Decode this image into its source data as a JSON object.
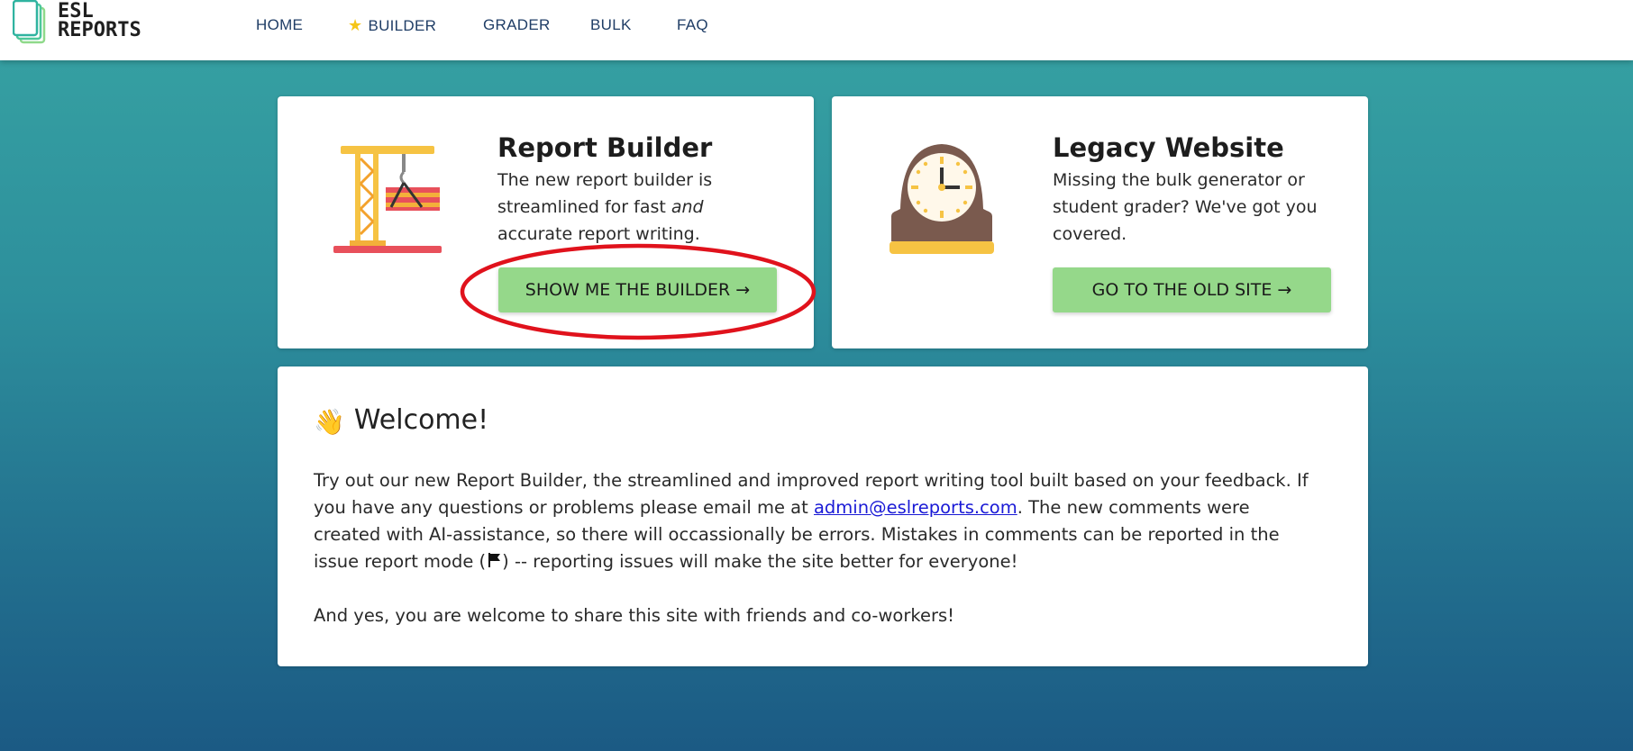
{
  "navbar": {
    "logo_line1": "ESL",
    "logo_line2": "REPORTS",
    "items": [
      {
        "label": "HOME"
      },
      {
        "label": "BUILDER",
        "icon": "star-icon"
      },
      {
        "label": "GRADER"
      },
      {
        "label": "BULK"
      },
      {
        "label": "FAQ"
      }
    ]
  },
  "builder_card": {
    "title": "Report Builder",
    "desc_part1": "The new report builder is streamlined for fast ",
    "desc_emphasis": "and",
    "desc_part2": " accurate report writing.",
    "button_label": "SHOW ME THE BUILDER →",
    "icon": "crane-icon"
  },
  "legacy_card": {
    "title": "Legacy Website",
    "desc": "Missing the bulk generator or student grader? We've got you covered.",
    "button_label": "GO TO THE OLD SITE →",
    "icon": "mantel-clock-icon"
  },
  "welcome": {
    "title": "Welcome!",
    "icon": "waving-hand-icon",
    "p1_part1": "Try out our new Report Builder, the streamlined and improved report writing tool built based on your feedback. If you have any questions or problems please email me at ",
    "email": "admin@eslreports.com",
    "p1_part2": ". The new comments were created with AI-assistance, so there will occassionally be errors. Mistakes in comments can be reported in the issue report mode (",
    "p1_part3": ") -- reporting issues will make the site better for everyone!",
    "p2": "And yes, you are welcome to share this site with friends and co-workers!"
  },
  "colors": {
    "accent_button": "#95d88a",
    "nav_text": "#1f3d66",
    "highlight": "#e0121c",
    "link": "#1a1ad6"
  }
}
